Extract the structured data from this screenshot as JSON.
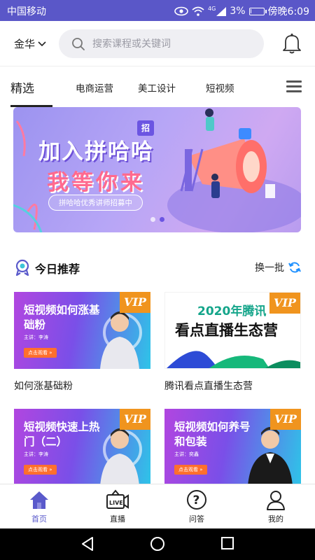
{
  "status_bar": {
    "carrier": "中国移动",
    "battery": "3%",
    "battery_level": 0.03,
    "time": "傍晚6:09",
    "network": "4G"
  },
  "header": {
    "city": "金华",
    "search_placeholder": "搜索课程或关键词"
  },
  "tabs": [
    {
      "label": "精选",
      "active": true
    },
    {
      "label": "电商运营",
      "active": false
    },
    {
      "label": "美工设计",
      "active": false
    },
    {
      "label": "短视频",
      "active": false
    }
  ],
  "banner": {
    "badge": "招",
    "title_line1": "加入拼哈哈",
    "title_line2": "我等你来",
    "subtitle": "拼哈哈优秀讲师招募中",
    "slides": 2,
    "current_slide": 1
  },
  "section": {
    "title": "今日推荐",
    "refresh_label": "换一批"
  },
  "cards": [
    {
      "thumb_title": "短视频如何涨基础粉",
      "host": "主讲：李涛",
      "button": "点击观看 »",
      "vip": "VIP",
      "label": "如何涨基础粉",
      "style": "purple"
    },
    {
      "thumb_title_1": "2020年腾讯",
      "thumb_title_2": "看点直播生态营",
      "vip": "VIP",
      "label": "腾讯看点直播生态营",
      "style": "white"
    },
    {
      "thumb_title": "短视频快速上热门（二）",
      "host": "主讲：李涛",
      "button": "点击观看 »",
      "vip": "VIP",
      "label": "",
      "style": "purple"
    },
    {
      "thumb_title": "短视频如何养号和包装",
      "host": "主讲：奕鑫",
      "button": "点击观看 »",
      "vip": "VIP",
      "label": "",
      "style": "purple"
    }
  ],
  "bottom_nav": [
    {
      "label": "首页",
      "icon": "home-icon",
      "active": true
    },
    {
      "label": "直播",
      "icon": "live-icon",
      "active": false
    },
    {
      "label": "问答",
      "icon": "question-icon",
      "active": false
    },
    {
      "label": "我的",
      "icon": "user-icon",
      "active": false
    }
  ],
  "colors": {
    "brand": "#5a57c8",
    "accent": "#5a5acb",
    "vip": "#f0941e",
    "refresh": "#1e90ff"
  }
}
